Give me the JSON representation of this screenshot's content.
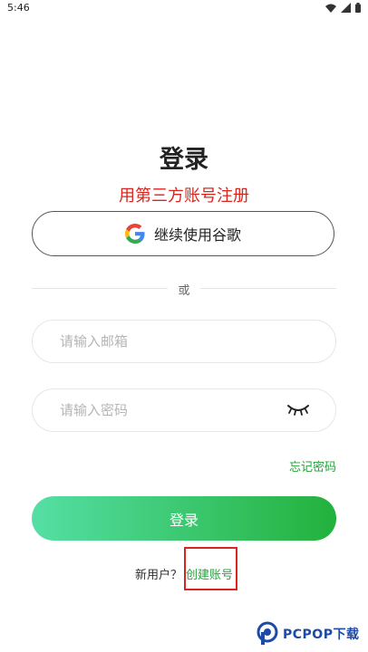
{
  "status_bar": {
    "time": "5:46",
    "icons": [
      "wifi-icon",
      "signal-icon",
      "battery-icon"
    ]
  },
  "login": {
    "title": "登录",
    "annotation": "用第三方账号注册",
    "google_button_label": "继续使用谷歌",
    "divider_text": "或",
    "email_placeholder": "请输入邮箱",
    "email_value": "",
    "password_placeholder": "请输入密码",
    "password_value": "",
    "forgot_password": "忘记密码",
    "submit_label": "登录",
    "new_user_text": "新用户？",
    "create_account": "创建账号"
  },
  "watermark": {
    "text": "PCPOP下载"
  },
  "colors": {
    "accent_green": "#22a33a",
    "gradient_start": "#55dfa5",
    "gradient_end": "#23b13c",
    "annotation_red": "#d5271f",
    "watermark_blue": "#1c4aa8"
  }
}
